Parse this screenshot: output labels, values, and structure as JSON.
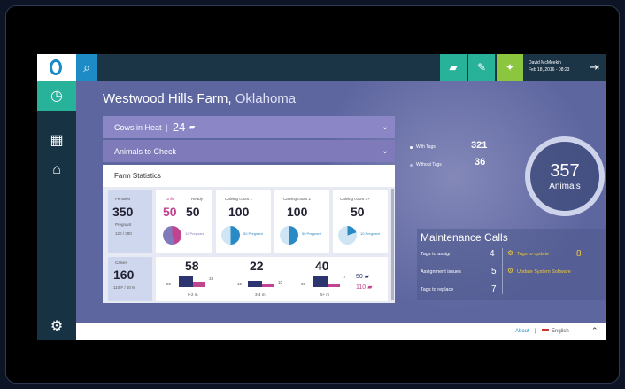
{
  "topbar": {
    "user_name": "David McMeekin",
    "user_date": "Feb 18, 2016 - 08:23"
  },
  "farm": {
    "name": "Westwood Hills Farm,",
    "state": "Oklahoma"
  },
  "cows_in_heat": {
    "label": "Cows in Heat",
    "count": "24"
  },
  "animals_to_check": {
    "label": "Animals to Check"
  },
  "farm_stats": {
    "title": "Farm Statistics",
    "females": {
      "label": "Females",
      "value": "350",
      "pregnant_label": "Pregnant",
      "pregnant_value": "120 / 300"
    },
    "cols": [
      {
        "header": "Unfit",
        "value": "50",
        "pie": "10 Pregnant"
      },
      {
        "header": "Ready",
        "value": "50",
        "pie": ""
      },
      {
        "header": "Calving count 1",
        "value": "100",
        "pie": "50 Pregnant"
      },
      {
        "header": "Calving count 2",
        "value": "100",
        "pie": "50 Pregnant"
      },
      {
        "header": "Calving count 3+",
        "value": "50",
        "pie": "10 Pregnant"
      }
    ],
    "calves": {
      "label": "Calves",
      "value": "160",
      "sub": "110 F / 50 M"
    },
    "calf_groups": [
      {
        "value": "58",
        "range": "0-2 m",
        "a": "25",
        "b": "33"
      },
      {
        "value": "22",
        "range": "3-4 m",
        "a": "12",
        "b": "10"
      },
      {
        "value": "40",
        "range": "5+ m",
        "a": "30",
        "b": "7"
      }
    ],
    "calf_males": "50",
    "calf_females": "110"
  },
  "tags": {
    "with_label": "With Tags",
    "with_value": "321",
    "without_label": "Without Tags",
    "without_value": "36",
    "total_value": "357",
    "total_label": "Animals"
  },
  "maintenance": {
    "title": "Maintenance Calls",
    "rows": [
      {
        "label": "Tags to assign",
        "value": "4"
      },
      {
        "label": "Assignment issues",
        "value": "5"
      },
      {
        "label": "Tags to replace",
        "value": "7"
      }
    ],
    "tags_to_update": {
      "label": "Tags to update",
      "value": "8"
    },
    "update_software": {
      "label": "Update System Software"
    }
  },
  "footer": {
    "about": "About",
    "language": "English"
  },
  "colors": {
    "accent": "#29b29a",
    "brand_blue": "#1c8bc6",
    "purple": "#8b86c6",
    "pink": "#c0448f",
    "navy": "#2c3570"
  }
}
